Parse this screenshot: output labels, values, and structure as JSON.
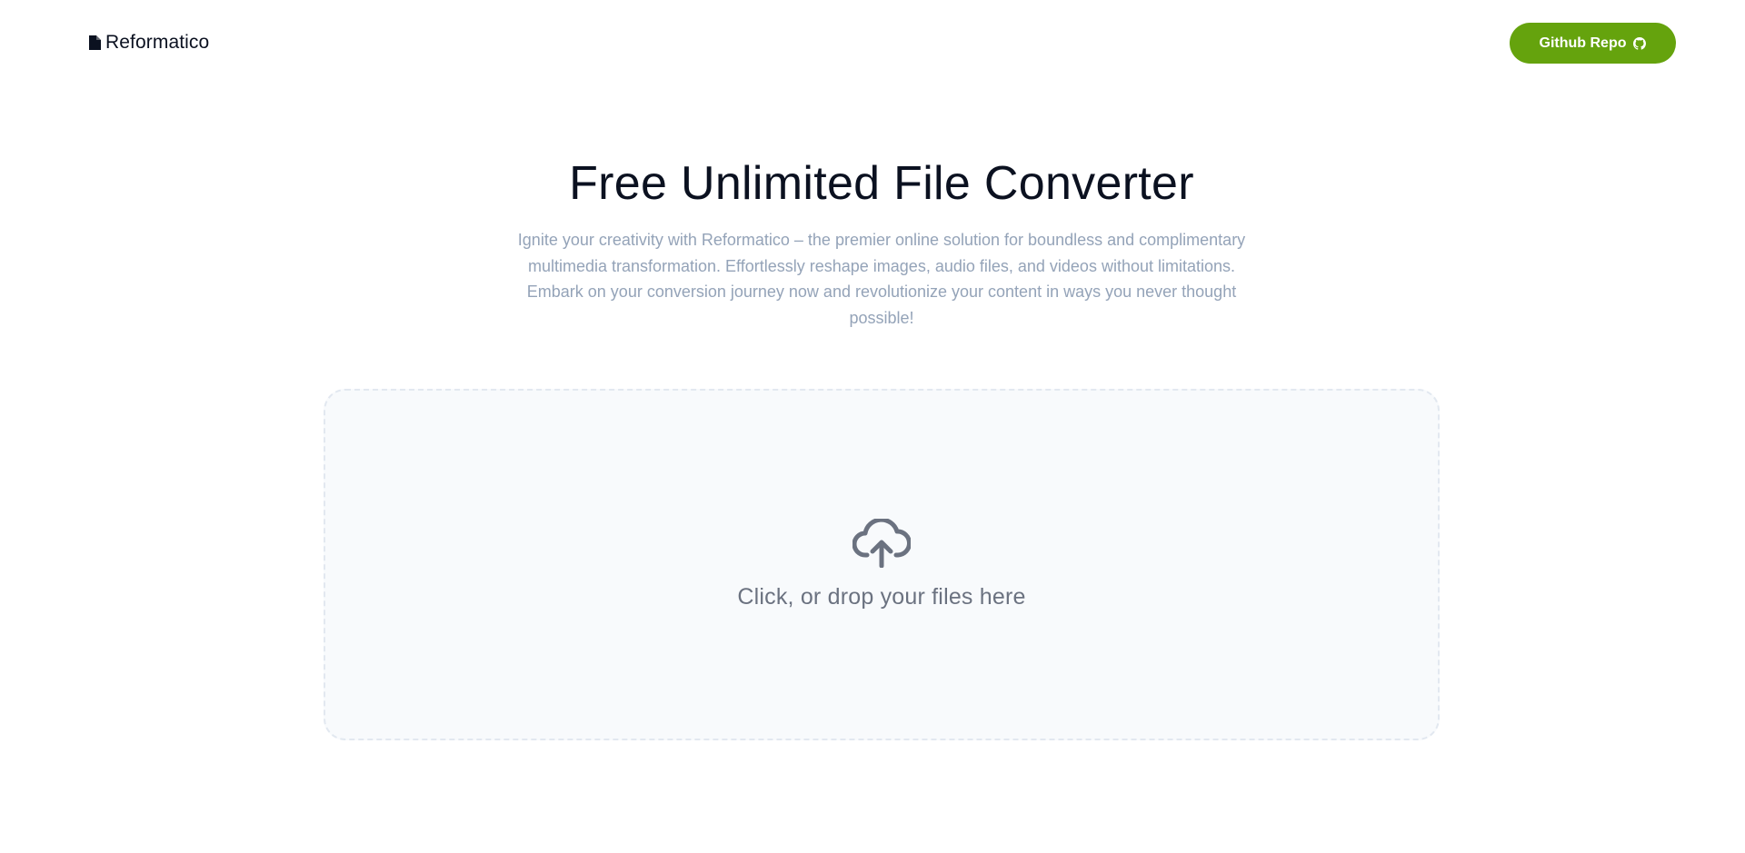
{
  "header": {
    "logo_text": "Reformatico",
    "github_button_label": "Github Repo"
  },
  "hero": {
    "title": "Free Unlimited File Converter",
    "description": "Ignite your creativity with Reformatico – the premier online solution for boundless and complimentary multimedia transformation. Effortlessly reshape images, audio files, and videos without limitations. Embark on your conversion journey now and revolutionize your content in ways you never thought possible!"
  },
  "dropzone": {
    "label": "Click, or drop your files here",
    "icon": "cloud-upload-icon"
  },
  "colors": {
    "accent": "#65a30d",
    "title": "#0b1120",
    "muted_text": "#94a3b8",
    "dropzone_bg": "#f8fafc",
    "dropzone_border": "#e2e8f0"
  }
}
